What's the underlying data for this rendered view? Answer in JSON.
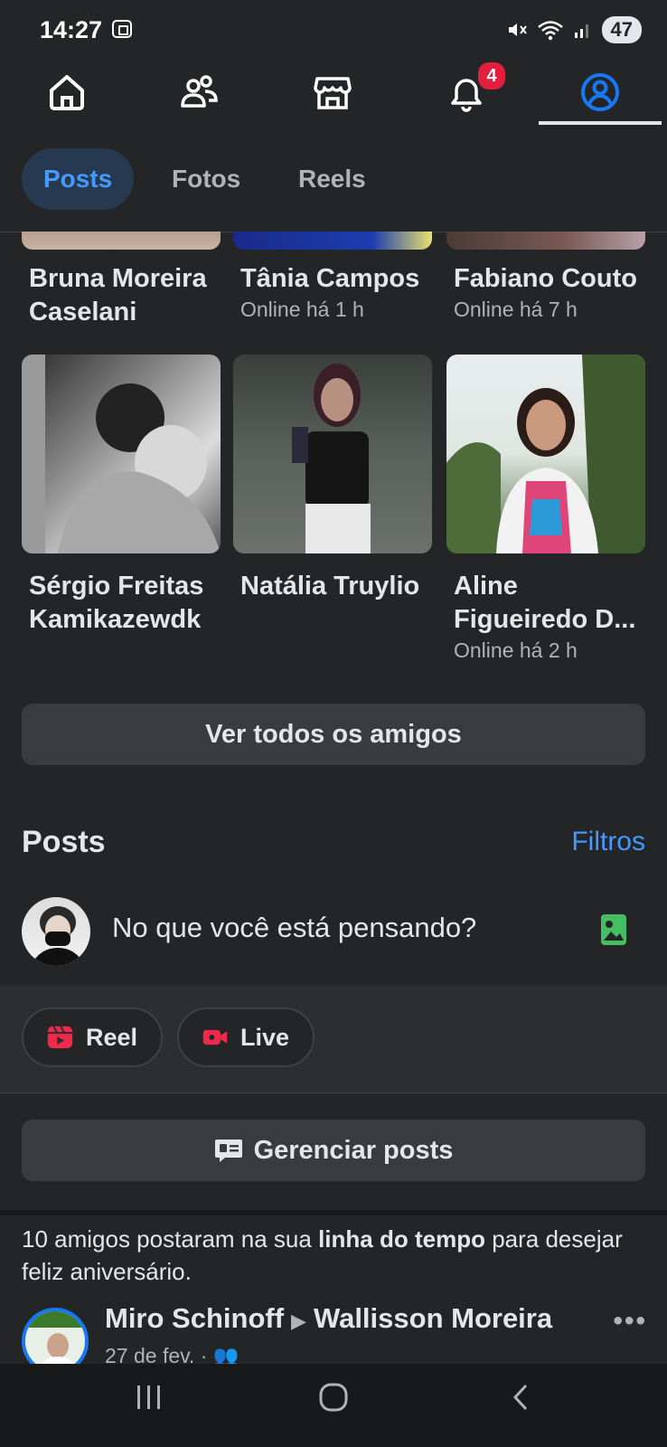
{
  "status_bar": {
    "time": "14:27",
    "battery": "47"
  },
  "top_nav": {
    "notification_count": "4",
    "active_tab": "profile"
  },
  "tabs": [
    {
      "label": "Posts",
      "active": true
    },
    {
      "label": "Fotos",
      "active": false
    },
    {
      "label": "Reels",
      "active": false
    }
  ],
  "friends_row1": [
    {
      "name": "Bruna Moreira Caselani",
      "status": ""
    },
    {
      "name": "Tânia Campos",
      "status": "Online há 1 h"
    },
    {
      "name": "Fabiano Couto",
      "status": "Online há 7 h"
    }
  ],
  "friends_row2": [
    {
      "name": "Sérgio Freitas Kamikazewdk",
      "status": ""
    },
    {
      "name": "Natália Truylio",
      "status": ""
    },
    {
      "name": "Aline Figueiredo D...",
      "status": "Online há 2 h"
    }
  ],
  "see_all_friends": "Ver todos os amigos",
  "posts_section": {
    "title": "Posts",
    "filters_label": "Filtros"
  },
  "composer": {
    "prompt": "No que você está pensando?"
  },
  "chips": {
    "reel": "Reel",
    "live": "Live"
  },
  "manage_posts": "Gerenciar posts",
  "birthday_notice": {
    "prefix": "10 amigos postaram na sua ",
    "bold": "linha do tempo",
    "suffix": " para desejar feliz aniversário."
  },
  "post": {
    "author": "Miro Schinoff",
    "target": "Wallisson Moreira",
    "date": "27 de fev. ·"
  },
  "colors": {
    "background": "#242526",
    "accent_blue": "#4599ff",
    "badge_red": "#e41e3f",
    "reel_red": "#f02849",
    "photo_green": "#45bd62"
  }
}
